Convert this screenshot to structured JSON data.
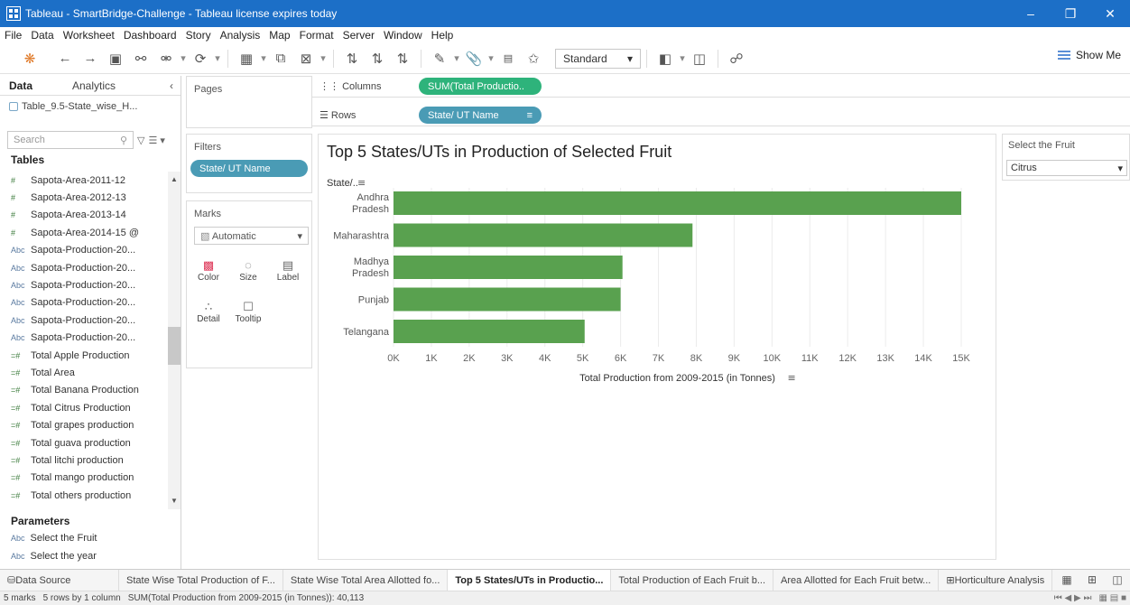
{
  "window": {
    "title": "Tableau - SmartBridge-Challenge - Tableau license expires today"
  },
  "menu": [
    "File",
    "Data",
    "Worksheet",
    "Dashboard",
    "Story",
    "Analysis",
    "Map",
    "Format",
    "Server",
    "Window",
    "Help"
  ],
  "toolbar": {
    "fit_dropdown": "Standard",
    "show_me": "Show Me"
  },
  "left_pane": {
    "tab_data": "Data",
    "tab_analytics": "Analytics",
    "data_source": "Table_9.5-State_wise_H...",
    "search_placeholder": "Search",
    "tables_header": "Tables",
    "fields": [
      {
        "type": "measure",
        "label": "Sapota-Area-2011-12"
      },
      {
        "type": "measure",
        "label": "Sapota-Area-2012-13"
      },
      {
        "type": "measure",
        "label": "Sapota-Area-2013-14"
      },
      {
        "type": "measure",
        "label": "Sapota-Area-2014-15 @"
      },
      {
        "type": "dim",
        "label": "Sapota-Production-20..."
      },
      {
        "type": "dim",
        "label": "Sapota-Production-20..."
      },
      {
        "type": "dim",
        "label": "Sapota-Production-20..."
      },
      {
        "type": "dim",
        "label": "Sapota-Production-20..."
      },
      {
        "type": "dim",
        "label": "Sapota-Production-20..."
      },
      {
        "type": "dim",
        "label": "Sapota-Production-20..."
      },
      {
        "type": "calc",
        "label": "Total Apple Production"
      },
      {
        "type": "calc",
        "label": "Total Area"
      },
      {
        "type": "calc",
        "label": "Total Banana Production"
      },
      {
        "type": "calc",
        "label": "Total Citrus Production"
      },
      {
        "type": "calc",
        "label": "Total grapes production"
      },
      {
        "type": "calc",
        "label": "Total guava production"
      },
      {
        "type": "calc",
        "label": "Total litchi production"
      },
      {
        "type": "calc",
        "label": "Total mango production"
      },
      {
        "type": "calc",
        "label": "Total others production"
      }
    ],
    "parameters_header": "Parameters",
    "parameters": [
      "Select the Fruit",
      "Select the year"
    ]
  },
  "pages": {
    "label": "Pages"
  },
  "filters": {
    "label": "Filters",
    "pill": "State/ UT Name"
  },
  "marks": {
    "label": "Marks",
    "type": "Automatic",
    "buttons": [
      "Color",
      "Size",
      "Label",
      "Detail",
      "Tooltip"
    ]
  },
  "shelves": {
    "columns_label": "Columns",
    "columns_pill": "SUM(Total Productio..",
    "rows_label": "Rows",
    "rows_pill": "State/ UT Name"
  },
  "viz": {
    "title": "Top 5 States/UTs in Production of Selected Fruit",
    "row_header": "State/.."
  },
  "filter_card": {
    "title": "Select the Fruit",
    "value": "Citrus"
  },
  "chart_data": {
    "type": "bar",
    "orientation": "horizontal",
    "categories": [
      "Andhra Pradesh",
      "Maharashtra",
      "Madhya Pradesh",
      "Punjab",
      "Telangana"
    ],
    "values": [
      15000,
      7900,
      6050,
      6000,
      5050
    ],
    "xlabel": "Total Production from 2009-2015 (in Tonnes)",
    "ylabel": "State/..",
    "xlim": [
      0,
      15500
    ],
    "xticks": [
      "0K",
      "1K",
      "2K",
      "3K",
      "4K",
      "5K",
      "6K",
      "7K",
      "8K",
      "9K",
      "10K",
      "11K",
      "12K",
      "13K",
      "14K",
      "15K"
    ],
    "bar_color": "#59a14f",
    "grid": "vertical"
  },
  "sheet_tabs": [
    {
      "label": "Data Source",
      "active": false
    },
    {
      "label": "State Wise Total Production of F...",
      "active": false
    },
    {
      "label": "State Wise Total Area Allotted fo...",
      "active": false
    },
    {
      "label": "Top 5 States/UTs in Productio...",
      "active": true
    },
    {
      "label": "Total Production of Each Fruit b...",
      "active": false
    },
    {
      "label": "Area Allotted for Each Fruit betw...",
      "active": false
    },
    {
      "label": "Horticulture Analysis",
      "active": false
    }
  ],
  "status": {
    "marks": "5 marks",
    "rows": "5 rows by 1 column",
    "sum": "SUM(Total Production from 2009-2015 (in Tonnes)): 40,113"
  }
}
